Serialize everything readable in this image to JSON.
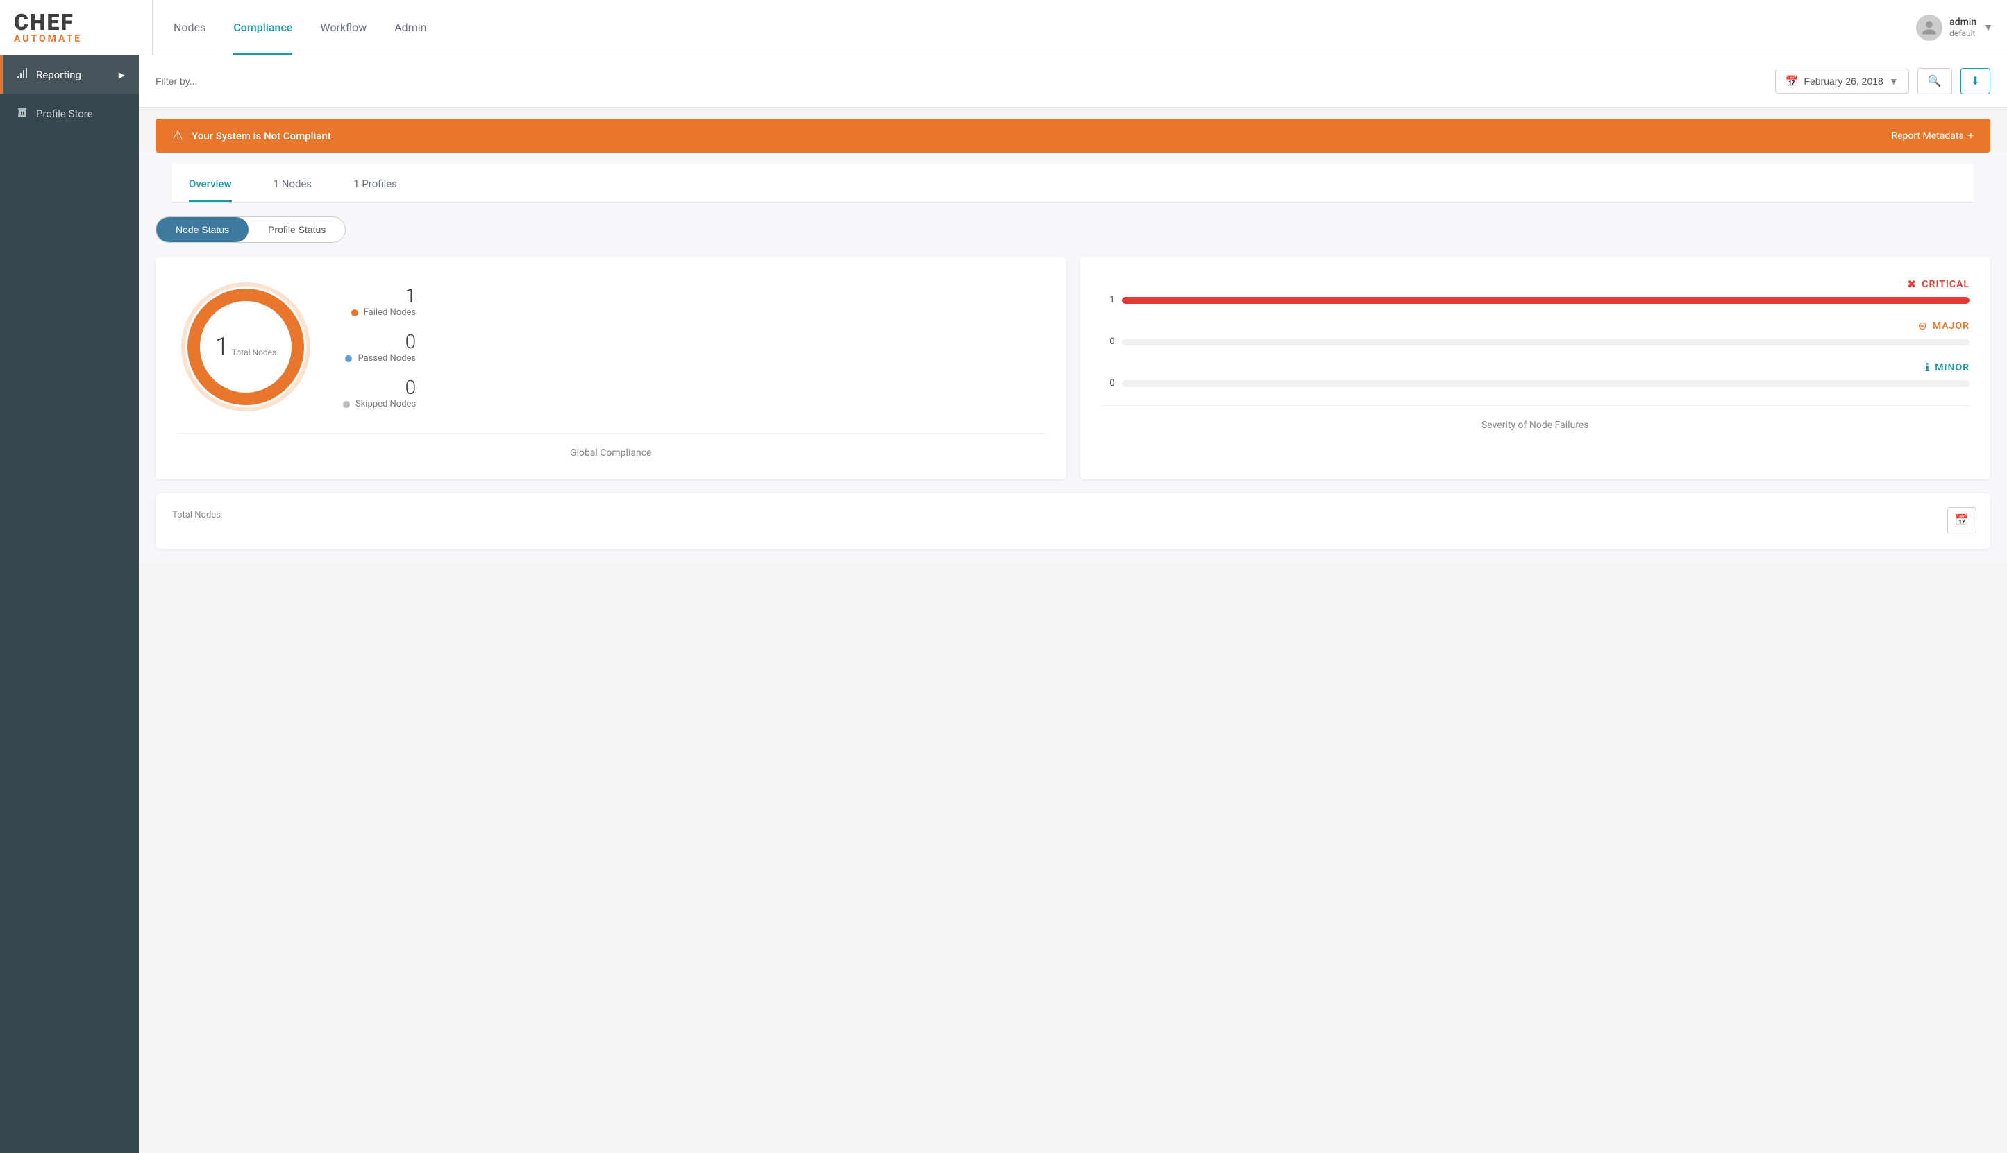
{
  "header": {
    "logo_chef": "CHEF",
    "logo_automate": "AUTOMATE",
    "nav_items": [
      {
        "label": "Nodes",
        "active": false
      },
      {
        "label": "Compliance",
        "active": true
      },
      {
        "label": "Workflow",
        "active": false
      },
      {
        "label": "Admin",
        "active": false
      }
    ],
    "user_name": "admin",
    "user_role": "default"
  },
  "sidebar": {
    "items": [
      {
        "label": "Reporting",
        "icon": "📈",
        "active": true,
        "has_arrow": true
      },
      {
        "label": "Profile Store",
        "icon": "📄",
        "active": false,
        "has_arrow": false
      }
    ]
  },
  "filter_bar": {
    "placeholder": "Filter by...",
    "date": "February 26, 2018",
    "search_icon": "🔍",
    "download_icon": "⬇"
  },
  "alert": {
    "icon": "⚠",
    "message": "Your System is Not Compliant",
    "action": "Report Metadata",
    "action_icon": "+"
  },
  "tabs": [
    {
      "label": "Overview",
      "active": true
    },
    {
      "label": "1 Nodes",
      "active": false
    },
    {
      "label": "1 Profiles",
      "active": false
    }
  ],
  "toggle": {
    "buttons": [
      {
        "label": "Node Status",
        "active": true
      },
      {
        "label": "Profile Status",
        "active": false
      }
    ]
  },
  "global_compliance": {
    "total_nodes": "1",
    "total_nodes_label": "Total Nodes",
    "failed_nodes_count": "1",
    "failed_nodes_label": "Failed Nodes",
    "passed_nodes_count": "0",
    "passed_nodes_label": "Passed Nodes",
    "skipped_nodes_count": "0",
    "skipped_nodes_label": "Skipped Nodes",
    "chart_label": "Global Compliance",
    "donut": {
      "failed_pct": 100,
      "passed_pct": 0
    }
  },
  "severity": {
    "chart_label": "Severity of Node Failures",
    "critical": {
      "label": "CRITICAL",
      "count": "1",
      "bar_pct": 100
    },
    "major": {
      "label": "MAJOR",
      "count": "0",
      "bar_pct": 0
    },
    "minor": {
      "label": "MINOR",
      "count": "0",
      "bar_pct": 0
    }
  },
  "bottom_card": {
    "label": "Total Nodes"
  }
}
